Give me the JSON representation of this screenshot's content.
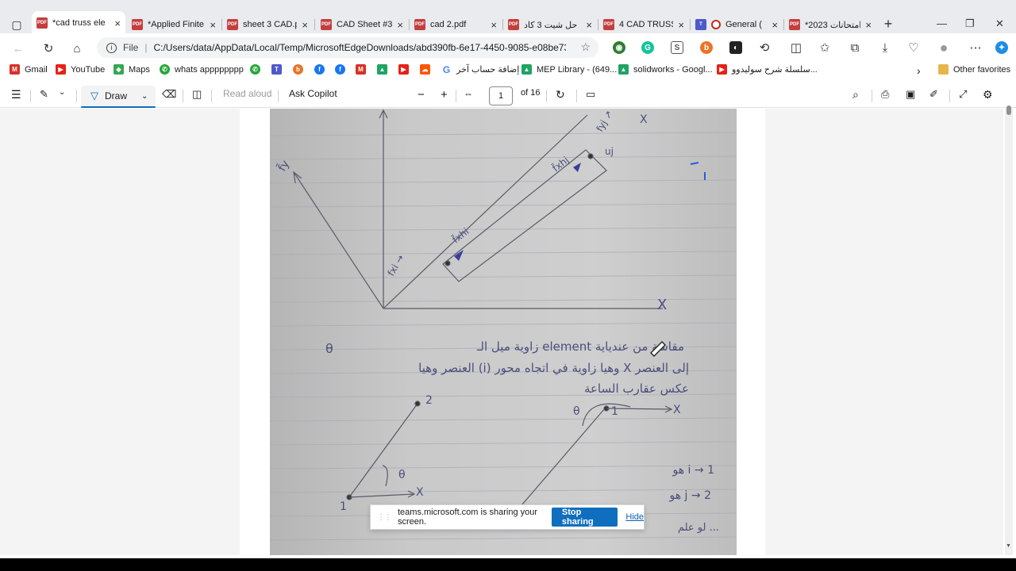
{
  "browser": {
    "tabs": [
      {
        "label": "*cad truss ele",
        "active": true
      },
      {
        "label": "*Applied Finite",
        "active": false
      },
      {
        "label": "sheet 3 CAD.p",
        "active": false
      },
      {
        "label": "CAD Sheet #3",
        "active": false
      },
      {
        "label": "cad 2.pdf",
        "active": false
      },
      {
        "label": "حل شيت 3 كاد",
        "active": false
      },
      {
        "label": "4 CAD TRUSS",
        "active": false
      },
      {
        "label": "General (",
        "active": false
      },
      {
        "label": "*امتحانات 2023",
        "active": false
      }
    ],
    "pdf_badge": "PDF",
    "close_glyph": "×",
    "new_tab_glyph": "+",
    "window_controls": {
      "minimize": "—",
      "maximize": "❐",
      "close": "✕"
    },
    "address": {
      "scheme": "File",
      "url": "C:/Users/data/AppData/Local/Temp/MicrosoftEdgeDownloads/abd390fb-6e17-4450-9085-e08be73..."
    },
    "favorites": [
      {
        "label": "Gmail",
        "icon": "gmail-icon",
        "color": "#d93025"
      },
      {
        "label": "YouTube",
        "icon": "youtube-icon",
        "color": "#e62117"
      },
      {
        "label": "Maps",
        "icon": "maps-icon",
        "color": "#34a853"
      },
      {
        "label": "whats apppppppp",
        "icon": "whatsapp-icon",
        "color": "#25a73b"
      },
      {
        "label": "",
        "icon": "whatsapp-icon",
        "color": "#25a73b"
      },
      {
        "label": "",
        "icon": "teams-icon",
        "color": "#5059c9"
      },
      {
        "label": "",
        "icon": "orange-circle-icon",
        "color": "#e8742a"
      },
      {
        "label": "",
        "icon": "facebook-icon",
        "color": "#1877f2"
      },
      {
        "label": "",
        "icon": "facebook-icon",
        "color": "#1877f2"
      },
      {
        "label": "",
        "icon": "gmail-icon",
        "color": "#d93025"
      },
      {
        "label": "",
        "icon": "drive-icon",
        "color": "#1fa463"
      },
      {
        "label": "",
        "icon": "youtube-icon",
        "color": "#e62117"
      },
      {
        "label": "",
        "icon": "soundcloud-icon",
        "color": "#ff5500"
      },
      {
        "label": "إضافة حساب آخر",
        "icon": "google-icon",
        "color": "#4285f4"
      },
      {
        "label": "MEP Library - (649...",
        "icon": "drive-icon",
        "color": "#1fa463"
      },
      {
        "label": "solidworks - Googl...",
        "icon": "drive-icon",
        "color": "#1fa463"
      },
      {
        "label": "سلسلة شرح سوليدوو...",
        "icon": "youtube-icon",
        "color": "#e62117"
      }
    ],
    "more_favorites_glyph": "›",
    "other_favorites": "Other favorites"
  },
  "pdf_toolbar": {
    "draw_label": "Draw",
    "read_aloud": "Read aloud",
    "ask_copilot": "Ask Copilot",
    "page_current": "1",
    "page_total": "of 16",
    "zoom_out": "−",
    "zoom_in": "+"
  },
  "document": {
    "handwriting": {
      "line1": "زاوية ميل الـ element مقاسة من عندياية",
      "line2": "العنصر وهيا (i) وهيا زاوية في اتجاه محور X إلى العنصر",
      "line3": "عكس عقارب الساعة",
      "axis_x": "X",
      "axis_y": "y",
      "theta": "θ",
      "node1": "1",
      "node2": "2",
      "note_i": "هو i → 1",
      "note_j": "هو j → 2",
      "bottom": "لو علم ..."
    }
  },
  "share_notice": {
    "message": "teams.microsoft.com is sharing your screen.",
    "stop_label": "Stop sharing",
    "hide_label": "Hide"
  }
}
